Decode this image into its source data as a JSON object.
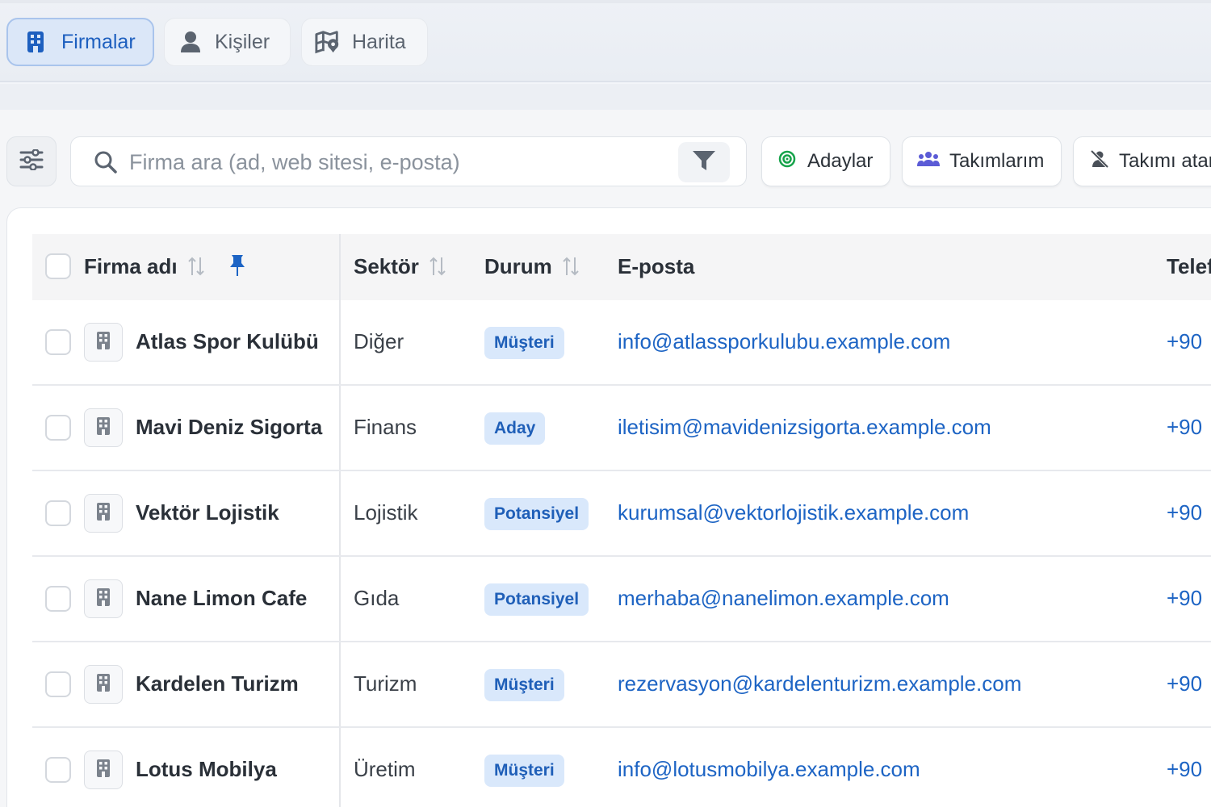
{
  "tabs": [
    {
      "label": "Firmalar",
      "icon": "building-icon",
      "active": true
    },
    {
      "label": "Kişiler",
      "icon": "person-icon",
      "active": false
    },
    {
      "label": "Harita",
      "icon": "map-pin-icon",
      "active": false
    }
  ],
  "toolbar": {
    "search_placeholder": "Firma ara (ad, web sitesi, e-posta)",
    "chips": [
      {
        "label": "Adaylar",
        "icon": "target-icon"
      },
      {
        "label": "Takımlarım",
        "icon": "team-icon"
      },
      {
        "label": "Takımı atan",
        "icon": "person-off-icon"
      }
    ]
  },
  "table": {
    "headers": {
      "name": "Firma adı",
      "sector": "Sektör",
      "status": "Durum",
      "email": "E-posta",
      "phone": "Telefon"
    },
    "rows": [
      {
        "name": "Atlas Spor Kulübü",
        "sector": "Diğer",
        "status": "Müşteri",
        "email": "info@atlassporkulubu.example.com",
        "phone": "+90"
      },
      {
        "name": "Mavi Deniz Sigorta",
        "sector": "Finans",
        "status": "Aday",
        "email": "iletisim@mavidenizsigorta.example.com",
        "phone": "+90"
      },
      {
        "name": "Vektör Lojistik",
        "sector": "Lojistik",
        "status": "Potansiyel",
        "email": "kurumsal@vektorlojistik.example.com",
        "phone": "+90"
      },
      {
        "name": "Nane Limon Cafe",
        "sector": "Gıda",
        "status": "Potansiyel",
        "email": "merhaba@nanelimon.example.com",
        "phone": "+90"
      },
      {
        "name": "Kardelen Turizm",
        "sector": "Turizm",
        "status": "Müşteri",
        "email": "rezervasyon@kardelenturizm.example.com",
        "phone": "+90"
      },
      {
        "name": "Lotus Mobilya",
        "sector": "Üretim",
        "status": "Müşteri",
        "email": "info@lotusmobilya.example.com",
        "phone": "+90"
      }
    ]
  },
  "colors": {
    "accent": "#1d64c4",
    "badge_bg": "#d9e8fb",
    "active_tab_bg": "#dbe7f8",
    "target_green": "#16a34a",
    "team_purple": "#5b5bd6"
  }
}
